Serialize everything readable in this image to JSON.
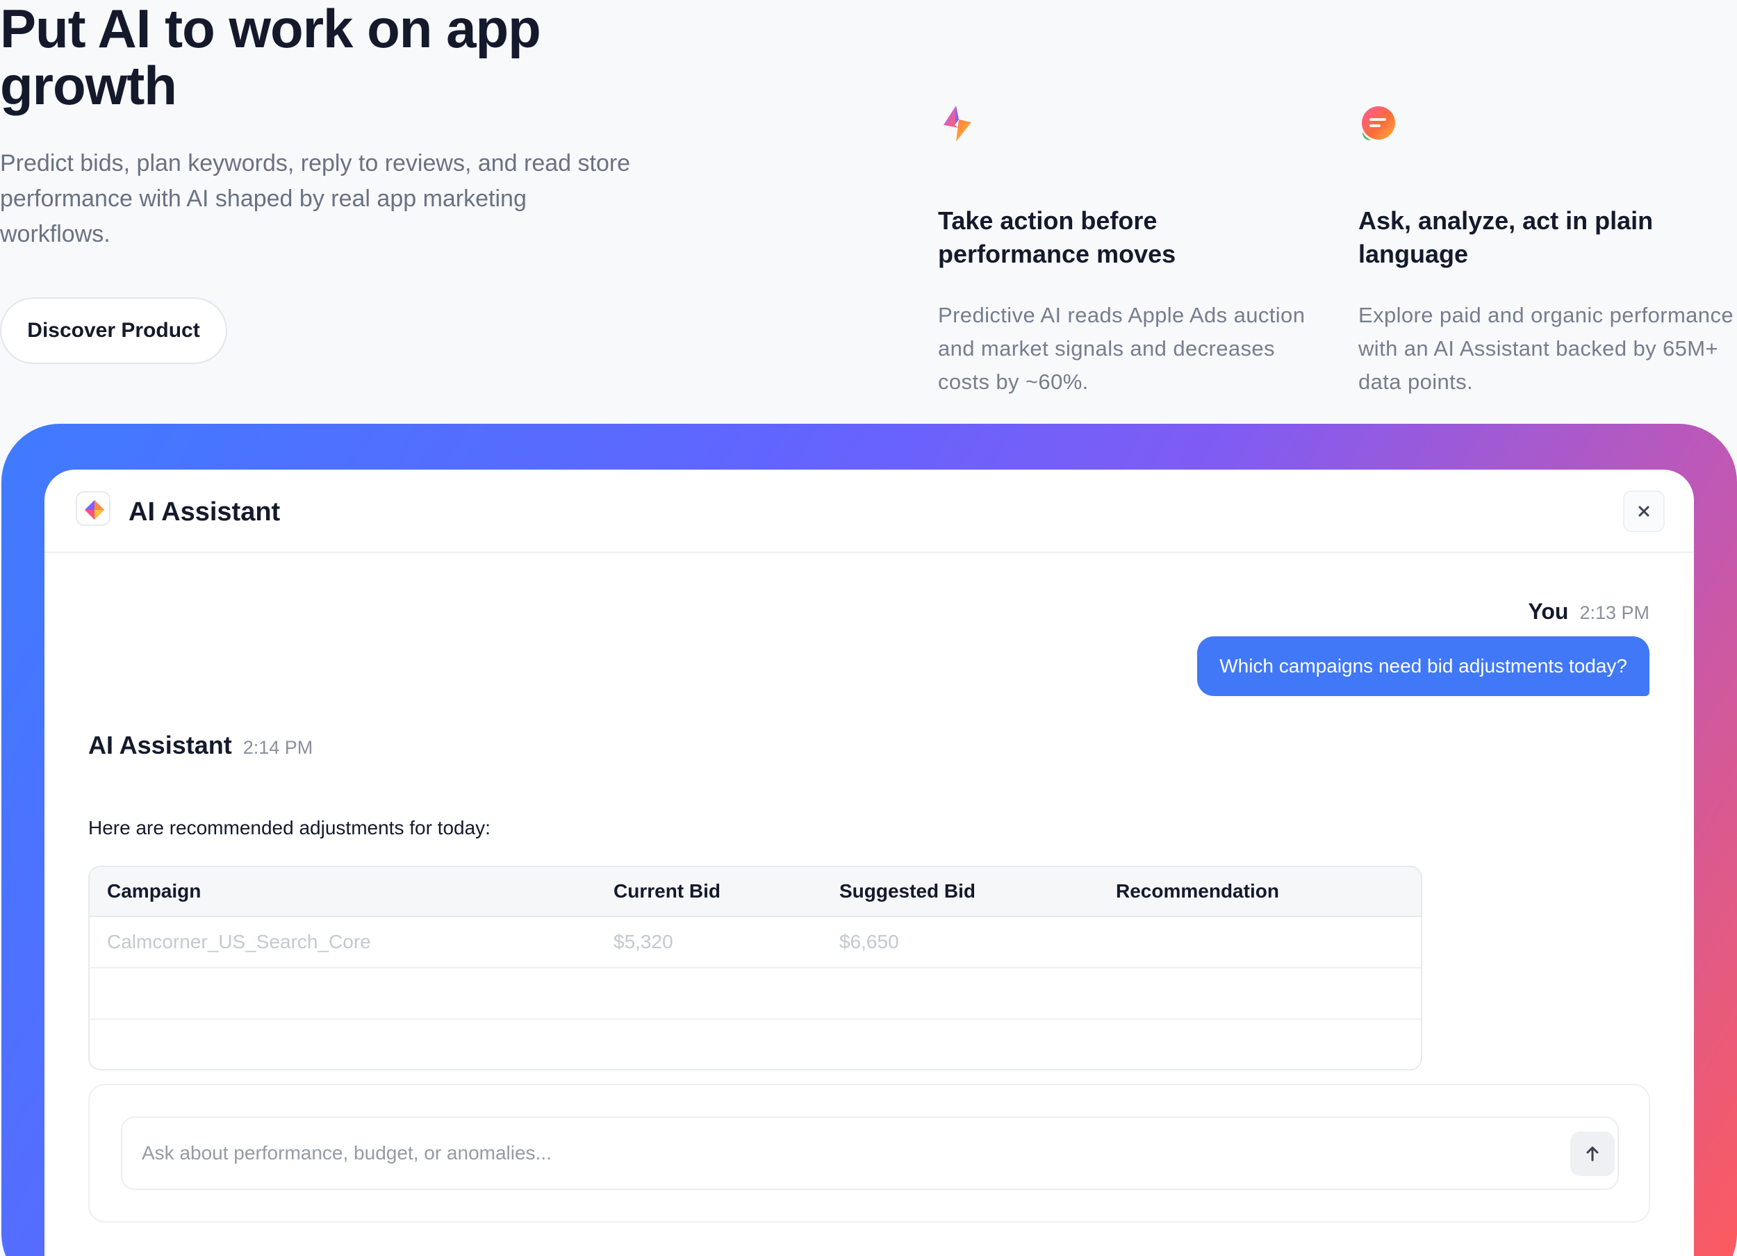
{
  "hero": {
    "title": "Put AI to work on app growth",
    "subtitle": "Predict bids, plan keywords, reply to reviews, and read store performance with AI shaped by real app marketing workflows.",
    "cta_label": "Discover Product"
  },
  "features": [
    {
      "icon": "lightning-bolt-icon",
      "title": "Take action before performance moves",
      "text": "Predictive AI reads Apple Ads auction and market signals and decreases costs by ~60%."
    },
    {
      "icon": "chat-bubble-icon",
      "title": "Ask, analyze, act in plain language",
      "text": "Explore paid and organic performance with an AI Assistant backed by 65M+ data points."
    }
  ],
  "assistant": {
    "title": "AI Assistant",
    "close_icon": "close-icon",
    "messages": {
      "user": {
        "name": "You",
        "time": "2:13 PM",
        "text": "Which campaigns need bid adjustments today?"
      },
      "ai": {
        "name": "AI Assistant",
        "time": "2:14 PM",
        "text": "Here are recommended adjustments for today:"
      }
    },
    "table": {
      "headers": [
        "Campaign",
        "Current Bid",
        "Suggested Bid",
        "Recommendation"
      ],
      "rows": [
        [
          "Calmcorner_US_Search_Core",
          "$5,320",
          "$6,650",
          ""
        ]
      ]
    },
    "input": {
      "placeholder": "Ask about performance, budget, or anomalies...",
      "value": ""
    },
    "send_icon": "arrow-up-icon"
  },
  "colors": {
    "accent": "#4178f7",
    "gradient_start": "#3f7bff",
    "gradient_mid": "#7f5cf4",
    "gradient_end": "#ff5b5b",
    "text_primary": "#141a2c",
    "text_muted": "#6a7183"
  }
}
